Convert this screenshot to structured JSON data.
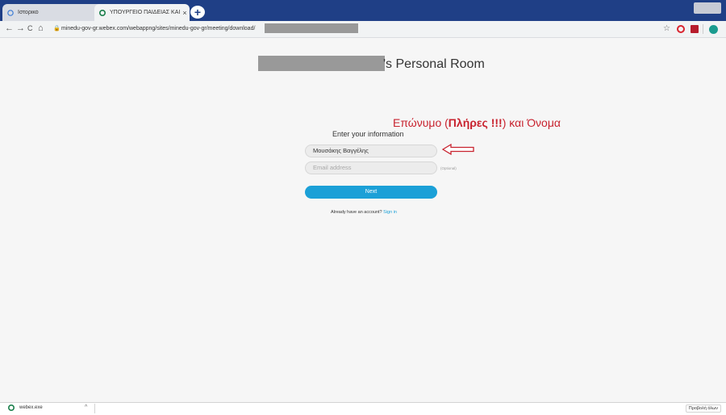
{
  "browser": {
    "tabs": [
      {
        "title": "Ιστορικό",
        "close": "×"
      },
      {
        "title": "ΥΠΟΥΡΓΕΙΟ ΠΑΙΔΕΙΑΣ ΚΑΙ ΘΡΗΣ",
        "close": "×"
      }
    ],
    "new_tab": "+",
    "back": "←",
    "forward": "→",
    "reload": "C",
    "home": "⌂",
    "url": "minedu-gov-gr.webex.com/webappng/sites/minedu-gov-gr/meeting/download/",
    "star": "☆"
  },
  "page": {
    "room_title": "'s Personal Room",
    "annotation_pre": "Επώνυμο (",
    "annotation_bold": "Πλήρες !!!",
    "annotation_post": ") και Όνομα",
    "form_heading": "Enter your information",
    "name_value": "Μουσάκης Βαγγέλης",
    "email_placeholder": "Email address",
    "optional_label": "(Optional)",
    "next_label": "Next",
    "account_text": "Already have an account?",
    "signin_label": "Sign in"
  },
  "downloads": {
    "file_name": "webex.exe",
    "chevron": "^",
    "show_all": "Προβολή όλων"
  },
  "colors": {
    "accent": "#1ba0d7",
    "annotation": "#c8232f",
    "titlebar": "#1f3f86"
  },
  "icons": [
    "history-icon",
    "webex-icon",
    "lock-icon",
    "star-icon",
    "opera-icon",
    "extension-icon",
    "profile-icon",
    "red-arrow-icon"
  ]
}
